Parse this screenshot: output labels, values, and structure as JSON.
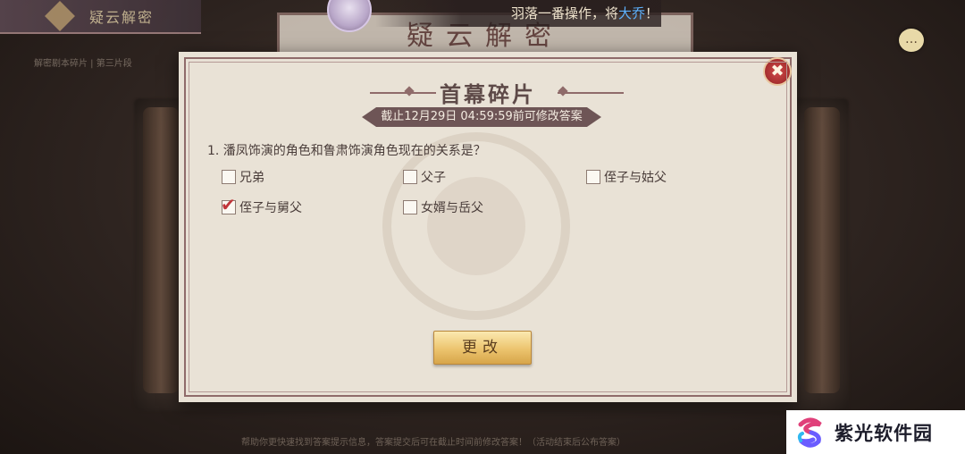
{
  "header": {
    "tab_label": "疑云解密",
    "tab_subtitle": "解密剧本碎片 | 第三片段",
    "background_title": "疑云解密",
    "announcement_prefix": "羽落一番操作，将",
    "announcement_highlight": "大乔",
    "announcement_suffix": "！"
  },
  "dialog": {
    "title": "首幕碎片",
    "deadline": "截止12月29日 04:59:59前可修改答案",
    "question": "1. 潘凤饰演的角色和鲁肃饰演角色现在的关系是？",
    "options": [
      {
        "label": "兄弟",
        "checked": false
      },
      {
        "label": "父子",
        "checked": false
      },
      {
        "label": "侄子与姑父",
        "checked": false
      },
      {
        "label": "侄子与舅父",
        "checked": true
      },
      {
        "label": "女婿与岳父",
        "checked": false
      }
    ],
    "check_mark": "✔",
    "close_symbol": "✖",
    "change_button": "更改"
  },
  "chat_icon_glyph": "…",
  "bottom_hint": "帮助你更快速找到答案提示信息，答案提交后可在截止时间前修改答案！（活动结束后公布答案）",
  "watermark": {
    "text": "紫光软件园",
    "colors": [
      "#e0407a",
      "#6a5cff",
      "#30b8f0"
    ]
  }
}
